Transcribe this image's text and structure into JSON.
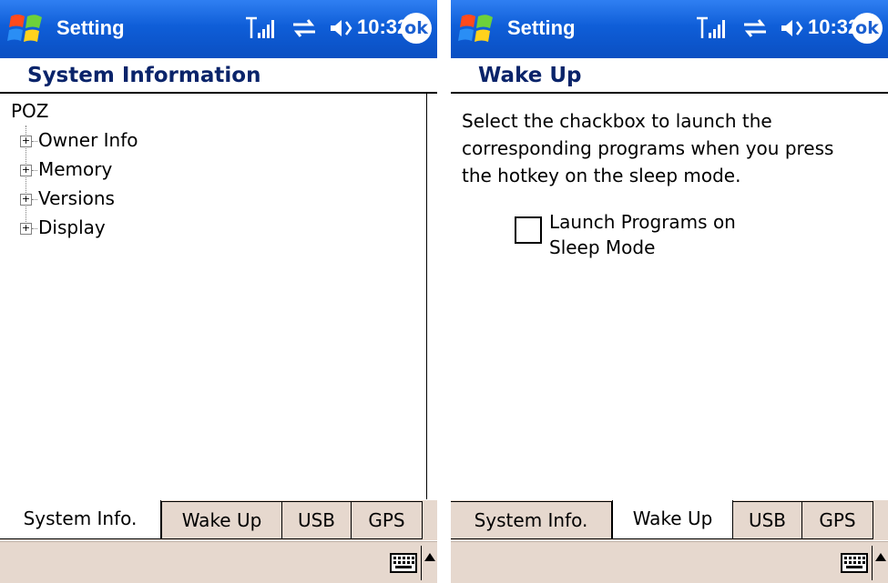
{
  "left_screen": {
    "app_title": "Setting",
    "clock": "10:32",
    "ok_label": "ok",
    "page_heading": "System Information",
    "tree": {
      "root": "POZ",
      "nodes": [
        "Owner Info",
        "Memory",
        "Versions",
        "Display"
      ]
    },
    "tabs": [
      "System Info.",
      "Wake Up",
      "USB",
      "GPS"
    ],
    "active_tab": "System Info."
  },
  "right_screen": {
    "app_title": "Setting",
    "clock": "10:32",
    "ok_label": "ok",
    "page_heading": "Wake Up",
    "description_lines": [
      "Select the chackbox to launch the",
      "corresponding programs when you press",
      "the hotkey on the sleep mode."
    ],
    "checkbox": {
      "label_lines": [
        "Launch Programs on",
        "Sleep Mode"
      ],
      "checked": false
    },
    "tabs": [
      "System Info.",
      "Wake Up",
      "USB",
      "GPS"
    ],
    "active_tab": "Wake Up"
  },
  "icons": [
    "windows-start-icon",
    "signal-icon",
    "sync-icon",
    "volume-icon",
    "keyboard-icon",
    "input-arrow-icon"
  ],
  "colors": {
    "titlebar": "#0f5ed8",
    "heading_text": "#0a246a",
    "tab_background": "#e6d8ce"
  }
}
